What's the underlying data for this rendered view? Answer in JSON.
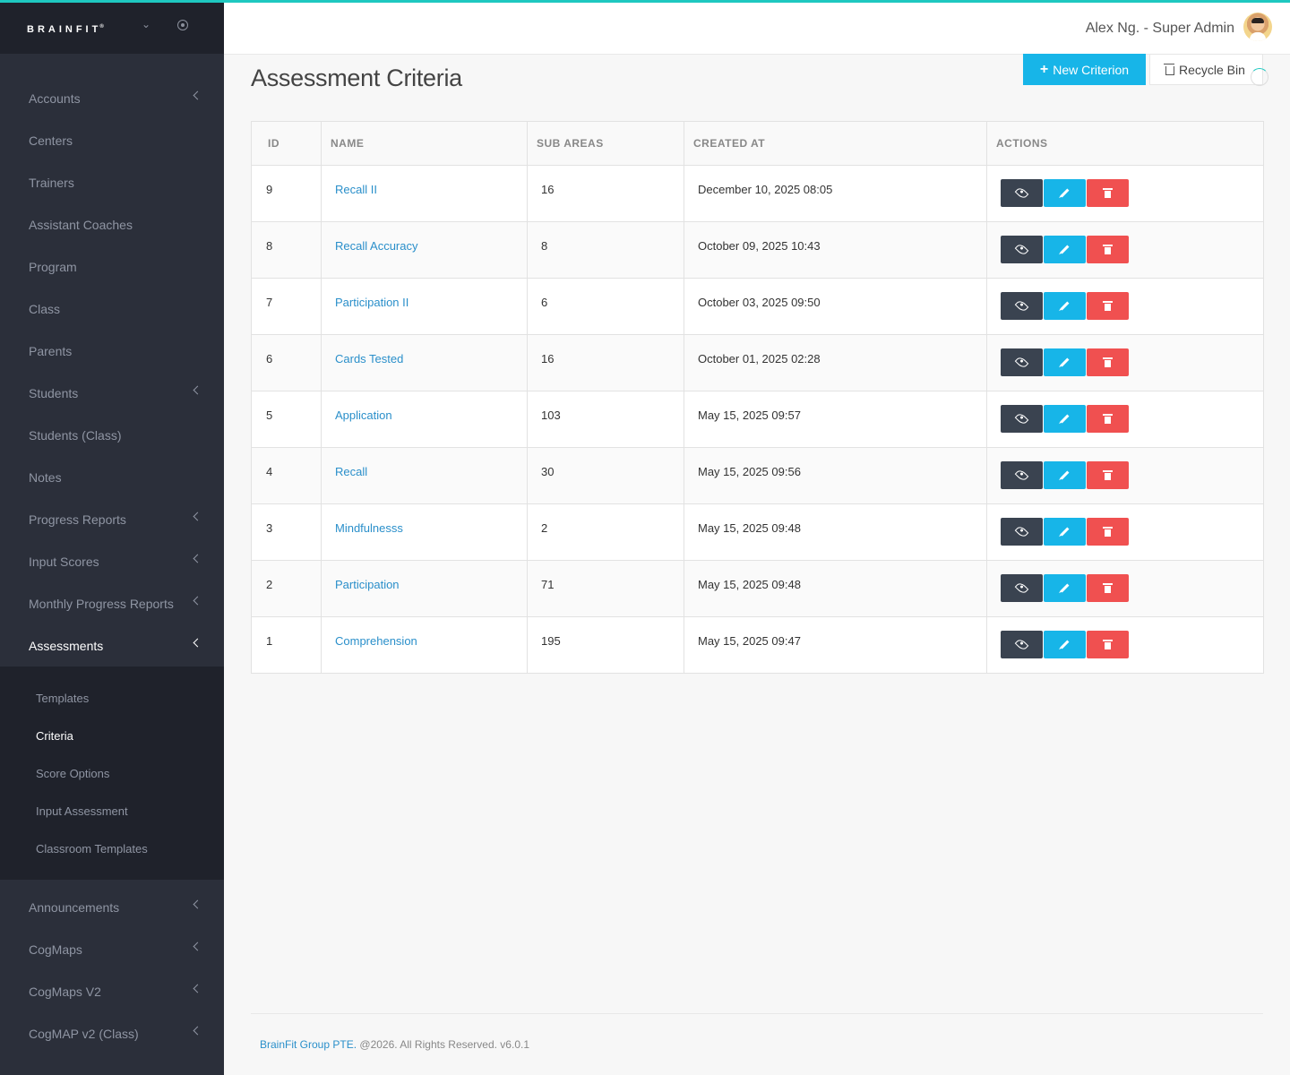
{
  "brand": {
    "name": "BRAINFIT",
    "mark": "®"
  },
  "header": {
    "user": "Alex Ng. - Super Admin"
  },
  "sidebar": {
    "items": [
      {
        "label": "Accounts",
        "chevron": true
      },
      {
        "label": "Centers",
        "chevron": false
      },
      {
        "label": "Trainers",
        "chevron": false
      },
      {
        "label": "Assistant Coaches",
        "chevron": false
      },
      {
        "label": "Program",
        "chevron": false
      },
      {
        "label": "Class",
        "chevron": false
      },
      {
        "label": "Parents",
        "chevron": false
      },
      {
        "label": "Students",
        "chevron": true
      },
      {
        "label": "Students (Class)",
        "chevron": false
      },
      {
        "label": "Notes",
        "chevron": false
      },
      {
        "label": "Progress Reports",
        "chevron": true
      },
      {
        "label": "Input Scores",
        "chevron": true
      },
      {
        "label": "Monthly Progress Reports",
        "chevron": true
      },
      {
        "label": "Assessments",
        "chevron": true,
        "active": true
      }
    ],
    "submenu": [
      {
        "label": "Templates"
      },
      {
        "label": "Criteria",
        "active": true
      },
      {
        "label": "Score Options"
      },
      {
        "label": "Input Assessment"
      },
      {
        "label": "Classroom Templates"
      }
    ],
    "items_after": [
      {
        "label": "Announcements",
        "chevron": true
      },
      {
        "label": "CogMaps",
        "chevron": true
      },
      {
        "label": "CogMaps V2",
        "chevron": true
      },
      {
        "label": "CogMAP v2 (Class)",
        "chevron": true
      }
    ]
  },
  "page": {
    "title": "Assessment Criteria",
    "new_button": "New Criterion",
    "recycle_button": "Recycle Bin"
  },
  "table": {
    "headers": [
      "ID",
      "NAME",
      "SUB AREAS",
      "CREATED AT",
      "ACTIONS"
    ],
    "rows": [
      {
        "id": "9",
        "name": "Recall II",
        "sub_areas": "16",
        "created_at": "December 10, 2025 08:05"
      },
      {
        "id": "8",
        "name": "Recall Accuracy",
        "sub_areas": "8",
        "created_at": "October 09, 2025 10:43"
      },
      {
        "id": "7",
        "name": "Participation II",
        "sub_areas": "6",
        "created_at": "October 03, 2025 09:50"
      },
      {
        "id": "6",
        "name": "Cards Tested",
        "sub_areas": "16",
        "created_at": "October 01, 2025 02:28"
      },
      {
        "id": "5",
        "name": "Application",
        "sub_areas": "103",
        "created_at": "May 15, 2025 09:57"
      },
      {
        "id": "4",
        "name": "Recall",
        "sub_areas": "30",
        "created_at": "May 15, 2025 09:56"
      },
      {
        "id": "3",
        "name": "Mindfulnesss",
        "sub_areas": "2",
        "created_at": "May 15, 2025 09:48"
      },
      {
        "id": "2",
        "name": "Participation",
        "sub_areas": "71",
        "created_at": "May 15, 2025 09:48"
      },
      {
        "id": "1",
        "name": "Comprehension",
        "sub_areas": "195",
        "created_at": "May 15, 2025 09:47"
      }
    ]
  },
  "footer": {
    "company": "BrainFit Group PTE.",
    "rights": " @2026. All Rights Reserved. v6.0.1"
  },
  "colors": {
    "accent": "#1ec8c0",
    "primary": "#17b5e8",
    "danger": "#f05050",
    "dark": "#3a4350",
    "sidebar": "#2b2f3a"
  }
}
